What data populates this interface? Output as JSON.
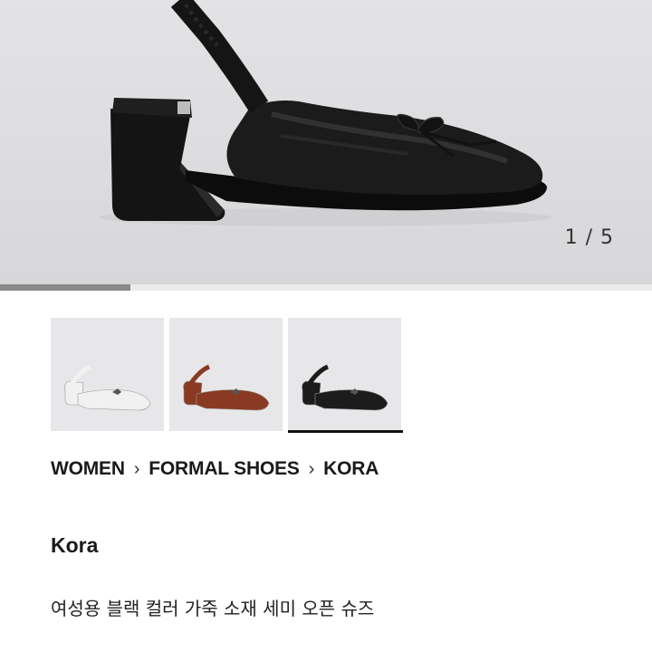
{
  "gallery": {
    "counter": "1 / 5",
    "current_index": 1,
    "total": 5,
    "progress_fraction": 0.2,
    "main_image_icon": "black-slingback-shoe-photo"
  },
  "thumbnails": [
    {
      "color_name": "white",
      "shoe_color": "#f1f1f1",
      "icon": "white-shoe-thumbnail",
      "selected": false
    },
    {
      "color_name": "brown",
      "shoe_color": "#8a3a22",
      "icon": "brown-shoe-thumbnail",
      "selected": false
    },
    {
      "color_name": "black",
      "shoe_color": "#1c1c1c",
      "icon": "black-shoe-thumbnail",
      "selected": true
    }
  ],
  "breadcrumb": {
    "items": [
      "WOMEN",
      "FORMAL SHOES",
      "KORA"
    ],
    "separator": "›"
  },
  "product": {
    "name": "Kora",
    "description": "여성용 블랙 컬러 가죽 소재 세미 오픈 슈즈"
  }
}
